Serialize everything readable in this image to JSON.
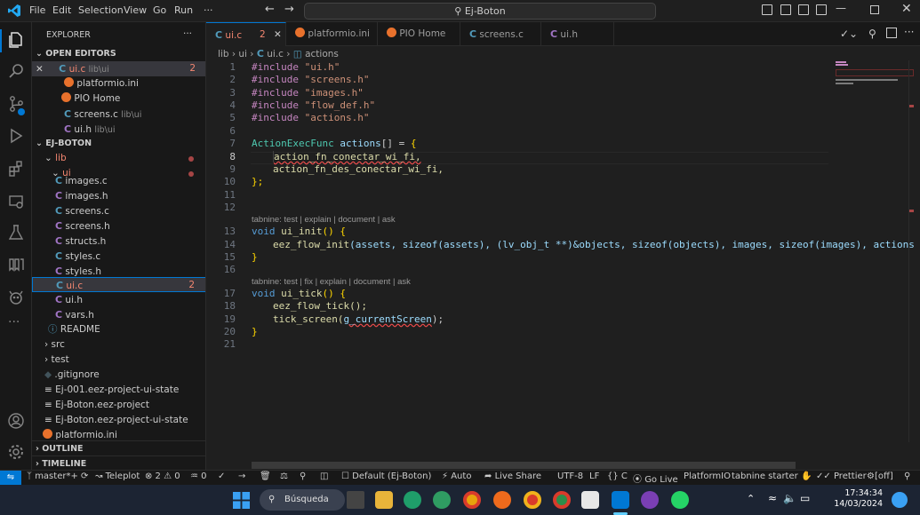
{
  "titlebar": {
    "menu": [
      "File",
      "Edit",
      "Selection",
      "View",
      "Go",
      "Run",
      "···"
    ],
    "search": "Ej-Boton",
    "accent": "#0078d4"
  },
  "sidebar": {
    "title": "EXPLORER",
    "more": "···",
    "open_editors_header": "OPEN EDITORS",
    "open_editors": [
      {
        "label": "ui.c",
        "desc": "lib\\ui",
        "badge": "2",
        "icon": "c-file-icon"
      },
      {
        "label": "platformio.ini",
        "desc": "",
        "badge": "",
        "icon": "platformio-icon"
      },
      {
        "label": "PIO Home",
        "desc": "",
        "badge": "",
        "icon": "platformio-icon"
      },
      {
        "label": "screens.c",
        "desc": "lib\\ui",
        "badge": "",
        "icon": "c-file-icon"
      },
      {
        "label": "ui.h",
        "desc": "lib\\ui",
        "badge": "",
        "icon": "c-file-icon"
      }
    ],
    "project_header": "EJ-BOTON",
    "tree": [
      {
        "label": "lib",
        "kind": "folder-open",
        "depth": 1
      },
      {
        "label": "ui",
        "kind": "folder-open",
        "depth": 2
      },
      {
        "label": "images.c",
        "kind": "c",
        "depth": 3
      },
      {
        "label": "images.h",
        "kind": "c",
        "depth": 3
      },
      {
        "label": "screens.c",
        "kind": "c",
        "depth": 3
      },
      {
        "label": "screens.h",
        "kind": "c",
        "depth": 3
      },
      {
        "label": "structs.h",
        "kind": "c",
        "depth": 3
      },
      {
        "label": "styles.c",
        "kind": "c",
        "depth": 3
      },
      {
        "label": "styles.h",
        "kind": "c",
        "depth": 3
      },
      {
        "label": "ui.c",
        "kind": "c",
        "depth": 3,
        "badge": "2"
      },
      {
        "label": "ui.h",
        "kind": "c",
        "depth": 3
      },
      {
        "label": "vars.h",
        "kind": "c",
        "depth": 3
      },
      {
        "label": "README",
        "kind": "info",
        "depth": 2
      },
      {
        "label": "src",
        "kind": "folder",
        "depth": 1
      },
      {
        "label": "test",
        "kind": "folder",
        "depth": 1
      },
      {
        "label": ".gitignore",
        "kind": "git",
        "depth": 1
      },
      {
        "label": "Ej-001.eez-project-ui-state",
        "kind": "list",
        "depth": 1
      },
      {
        "label": "Ej-Boton.eez-project",
        "kind": "list",
        "depth": 1
      },
      {
        "label": "Ej-Boton.eez-project-ui-state",
        "kind": "list",
        "depth": 1
      },
      {
        "label": "platformio.ini",
        "kind": "pio",
        "depth": 1
      }
    ],
    "outline": "OUTLINE",
    "timeline": "TIMELINE"
  },
  "tabs": [
    {
      "label": "ui.c",
      "badge": "2",
      "icon": "c-file-icon",
      "active": true
    },
    {
      "label": "platformio.ini",
      "badge": "",
      "icon": "platformio-icon",
      "active": false
    },
    {
      "label": "PIO Home",
      "badge": "",
      "icon": "platformio-icon",
      "active": false
    },
    {
      "label": "screens.c",
      "badge": "",
      "icon": "c-file-icon",
      "active": false
    },
    {
      "label": "ui.h",
      "badge": "",
      "icon": "c-file-icon",
      "active": false
    }
  ],
  "breadcrumb": [
    "lib",
    "ui",
    "ui.c",
    "actions"
  ],
  "editor": {
    "line_numbers": [
      "1",
      "2",
      "3",
      "4",
      "5",
      "6",
      "7",
      "8",
      "9",
      "10",
      "11",
      "12",
      "13",
      "14",
      "15",
      "16",
      "17",
      "18",
      "19",
      "20",
      "21"
    ],
    "includes": [
      "\"ui.h\"",
      "\"screens.h\"",
      "\"images.h\"",
      "\"flow_def.h\"",
      "\"actions.h\""
    ],
    "include_kw": "#include",
    "line7": {
      "type": "ActionExecFunc",
      "name": "actions",
      "rest": "[] = "
    },
    "line8": "action_fn_conectar_wi_fi,",
    "line9": "action_fn_des_conectar_wi_fi,",
    "line10": "};",
    "lens1": "tabnine: test | explain | document | ask",
    "line13": {
      "kw": "void",
      "fn": "ui_init",
      "rest": "() {"
    },
    "line14": {
      "fn": "eez_flow_init",
      "args": "(assets, sizeof(assets), (lv_obj_t **)&objects, sizeof(objects), images, sizeof(images), actions"
    },
    "lens2": "tabnine: test | fix | explain | document | ask",
    "line17": {
      "kw": "void",
      "fn": "ui_tick",
      "rest": "() {"
    },
    "line18": "eez_flow_tick();",
    "line19a": "tick_screen(",
    "line19b": "g_currentScreen",
    "line19c": ");",
    "close": "}"
  },
  "statusbar": {
    "branch": "master*+",
    "teleplot": "Teleplot",
    "problems": "⊗ 2 ⚠ 0",
    "ports": "♒ 0",
    "env": "Default (Ej-Boton)",
    "auto": "Auto",
    "liveshare": "Live Share",
    "encoding": "UTF-8",
    "eol": "LF",
    "lang": "{} C",
    "golive": "Go Live",
    "platformio": "PlatformIO",
    "tabnine": "tabnine starter",
    "prettier": "Prettier",
    "off": "[off]"
  },
  "taskbar": {
    "search": "Búsqueda",
    "time": "17:34:34",
    "date": "14/03/2024"
  }
}
